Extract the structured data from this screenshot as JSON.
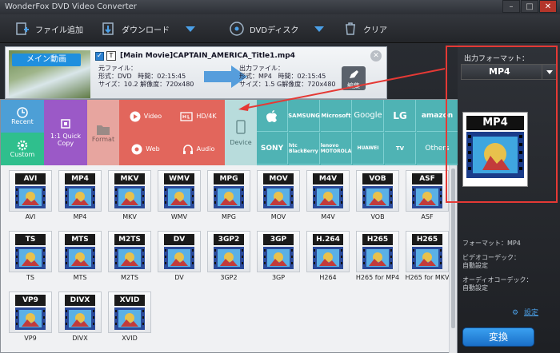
{
  "window": {
    "title": "WonderFox DVD Video Converter"
  },
  "toolbar": {
    "add_file": "ファイル追加",
    "download": "ダウンロード",
    "dvd_disc": "DVDディスク",
    "clear": "クリア"
  },
  "task": {
    "main_video_tag": "メイン動画",
    "file_name": "[Main Movie]CAPTAIN_AMERICA_Title1.mp4",
    "source": {
      "label": "元ファイル：",
      "format": "形式：DVD",
      "time": "時間：02:15:45",
      "size": "サイズ：10.2",
      "resolution": "解像度：720x480"
    },
    "output": {
      "label": "出力ファイル：",
      "format": "形式：MP4",
      "time": "時間：02:15:45",
      "size": "サイズ：1.5 G",
      "resolution": "解像度：720x480"
    },
    "subtitle_strip": "字幕",
    "edit_label": "編集"
  },
  "categories": {
    "recent": "Recent",
    "custom": "Custom",
    "quick_copy": "1:1 Quick Copy",
    "format": "Format",
    "video": "Video",
    "hd4k": "HD/4K",
    "web": "Web",
    "audio": "Audio",
    "device": "Device"
  },
  "brands": [
    "apple",
    "SAMSUNG",
    "Microsoft",
    "Google",
    "LG",
    "amazon",
    "SONY",
    "htc BlackBerry",
    "lenovo MOTOROLA",
    "HUAWEI",
    "TV",
    "Others"
  ],
  "formats": [
    {
      "top": "AVI",
      "label": "AVI"
    },
    {
      "top": "MP4",
      "label": "MP4"
    },
    {
      "top": "MKV",
      "label": "MKV"
    },
    {
      "top": "WMV",
      "label": "WMV"
    },
    {
      "top": "MPG",
      "label": "MPG"
    },
    {
      "top": "MOV",
      "label": "MOV"
    },
    {
      "top": "M4V",
      "label": "M4V"
    },
    {
      "top": "VOB",
      "label": "VOB"
    },
    {
      "top": "ASF",
      "label": "ASF"
    },
    {
      "top": "TS",
      "label": "TS"
    },
    {
      "top": "MTS",
      "label": "MTS"
    },
    {
      "top": "M2TS",
      "label": "M2TS"
    },
    {
      "top": "DV",
      "label": "DV"
    },
    {
      "top": "3GP2",
      "label": "3GP2"
    },
    {
      "top": "3GP",
      "label": "3GP"
    },
    {
      "top": "H.264",
      "label": "H264"
    },
    {
      "top": "H265",
      "label": "H265 for MP4"
    },
    {
      "top": "H265",
      "label": "H265 for MKV"
    },
    {
      "top": "VP9",
      "label": "VP9"
    },
    {
      "top": "DIVX",
      "label": "DIVX"
    },
    {
      "top": "XVID",
      "label": "XVID"
    }
  ],
  "output_panel": {
    "label": "出力フォーマット：",
    "selected": "MP4",
    "big_icon_title": "MP4",
    "format_info": "フォーマット：MP4",
    "video_codec": "ビデオコーデック：",
    "video_codec_value": "自動設定",
    "audio_codec": "オーディオコーデック：",
    "audio_codec_value": "自動設定",
    "setting": "設定",
    "convert": "変換"
  },
  "colors": {
    "accent": "#1f8fde",
    "highlight_red": "#e53935",
    "recent_blue": "#4d9fd6",
    "custom_green": "#2fbf8d",
    "quickcopy_purple": "#9b59c7",
    "video_red": "#e2665c",
    "device_teal": "#4fb3b4"
  }
}
